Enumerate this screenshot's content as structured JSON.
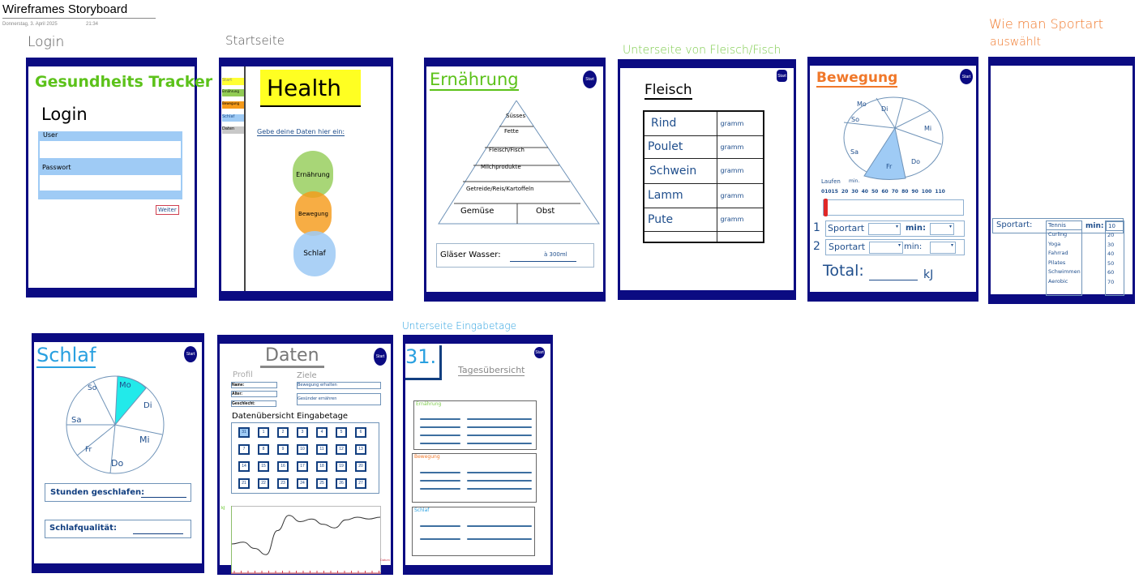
{
  "page": {
    "title": "Wireframes Storyboard",
    "date": "Donnerstag, 3. April 2025",
    "time": "21:34"
  },
  "colors": {
    "navy": "#0b0b82",
    "green": "#5cc21a",
    "orange": "#f0782a",
    "light_blue": "#9fcbf5"
  },
  "start_button_label": "Start",
  "login": {
    "caption": "Login",
    "app_title": "Gesundheits Tracker",
    "heading": "Login",
    "user_label": "User",
    "password_label": "Passwort",
    "next_button": "Weiter"
  },
  "startseite": {
    "caption": "Startseite",
    "nav": [
      "Start",
      "Ernährung",
      "Bewegung",
      "Schlaf",
      "Daten"
    ],
    "title": "Health",
    "prompt": "Gebe deine Daten hier ein:",
    "bubbles": [
      "Ernährung",
      "Bewegung",
      "Schlaf"
    ]
  },
  "ernaehrung": {
    "title": "Ernährung",
    "pyramid": [
      "Süsses",
      "Fette",
      "Fleisch/Fisch",
      "Milchprodukte",
      "Getreide/Reis/Kartoffeln",
      "Gemüse",
      "Obst"
    ],
    "water_label": "Gläser Wasser:",
    "water_unit": "à 300ml"
  },
  "fleisch": {
    "caption": "Unterseite von Fleisch/Fisch",
    "title": "Fleisch",
    "rows": [
      {
        "name": "Rind",
        "unit": "gramm"
      },
      {
        "name": "Poulet",
        "unit": "gramm"
      },
      {
        "name": "Schwein",
        "unit": "gramm"
      },
      {
        "name": "Lamm",
        "unit": "gramm"
      },
      {
        "name": "Pute",
        "unit": "gramm"
      }
    ]
  },
  "bewegung": {
    "title": "Bewegung",
    "days": [
      "Mo",
      "Di",
      "Mi",
      "Do",
      "Fr",
      "Sa",
      "So"
    ],
    "selected_day": "Fr",
    "activity_label": "Laufen",
    "min_label": "min.",
    "scale": [
      "0",
      "10",
      "15",
      "20",
      "30",
      "40",
      "50",
      "60",
      "70",
      "80",
      "90",
      "100",
      "110"
    ],
    "slider_value": 0,
    "rows": [
      {
        "num": "1",
        "label": "Sportart",
        "min": "min:"
      },
      {
        "num": "2",
        "label": "Sportart",
        "min": "min:"
      }
    ],
    "total_label": "Total:",
    "total_unit": "kJ"
  },
  "sportart": {
    "caption_line1": "Wie man Sportart",
    "caption_line2": "auswählt",
    "label": "Sportart:",
    "selected": "Tennis",
    "options": [
      "Curling",
      "Yoga",
      "Fahrrad",
      "Pilates",
      "Schwimmen",
      "Aerobic"
    ],
    "min_label": "min:",
    "min_selected": "10",
    "min_options": [
      "20",
      "30",
      "40",
      "50",
      "60",
      "70"
    ]
  },
  "schlaf": {
    "title": "Schlaf",
    "days": [
      "Mo",
      "Di",
      "Mi",
      "Do",
      "Fr",
      "Sa",
      "So"
    ],
    "selected_day": "Mo",
    "hours_label": "Stunden geschlafen:",
    "quality_label": "Schlafqualität:"
  },
  "daten": {
    "title": "Daten",
    "profile_heading": "Profil",
    "profile_fields": [
      "Name:",
      "Alter:",
      "Geschlecht:"
    ],
    "goals_heading": "Ziele",
    "goals": [
      "Bewegung erhalten",
      "Gesünder ernähren"
    ],
    "overview_heading": "Datenübersicht Eingabetage",
    "days": [
      "31",
      "1",
      "2",
      "3",
      "4",
      "5",
      "6",
      "7",
      "8",
      "9",
      "10",
      "11",
      "12",
      "13",
      "14",
      "15",
      "16",
      "17",
      "18",
      "19",
      "20",
      "21",
      "22",
      "23",
      "24",
      "25",
      "26",
      "27"
    ],
    "selected_day": "31",
    "chart_ylabel": "kJ",
    "chart_xlabel": "Datum",
    "chart_values": [
      30,
      32,
      25,
      18,
      45,
      62,
      55,
      58,
      52,
      48,
      57,
      60,
      58,
      60
    ]
  },
  "eingabetage": {
    "caption": "Unterseite Eingabetage",
    "day": "31.",
    "title": "Tagesübersicht",
    "sections": [
      "Ernährung",
      "Bewegung",
      "Schlaf"
    ]
  }
}
